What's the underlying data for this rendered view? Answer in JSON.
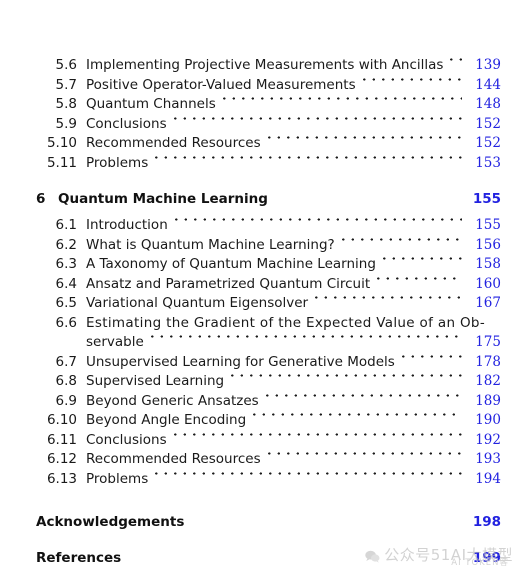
{
  "document": {
    "type": "table-of-contents"
  },
  "entries": [
    {
      "number": "5.6",
      "title": "Implementing Projective Measurements with Ancillas",
      "page": "139"
    },
    {
      "number": "5.7",
      "title": "Positive Operator-Valued Measurements",
      "page": "144"
    },
    {
      "number": "5.8",
      "title": "Quantum Channels",
      "page": "148"
    },
    {
      "number": "5.9",
      "title": "Conclusions",
      "page": "152"
    },
    {
      "number": "5.10",
      "title": "Recommended Resources",
      "page": "152"
    },
    {
      "number": "5.11",
      "title": "Problems",
      "page": "153"
    }
  ],
  "chapter": {
    "number": "6",
    "title": "Quantum Machine Learning",
    "page": "155"
  },
  "chapter_entries": [
    {
      "number": "6.1",
      "title": "Introduction",
      "page": "155"
    },
    {
      "number": "6.2",
      "title": "What is Quantum Machine Learning?",
      "page": "156"
    },
    {
      "number": "6.3",
      "title": "A Taxonomy of Quantum Machine Learning",
      "page": "158"
    },
    {
      "number": "6.4",
      "title": "Ansatz and Parametrized Quantum Circuit",
      "page": "160"
    },
    {
      "number": "6.5",
      "title": "Variational Quantum Eigensolver",
      "page": "167"
    }
  ],
  "wrapped_entry": {
    "number": "6.6",
    "title_line1": "Estimating the Gradient of the Expected Value of an Ob-",
    "title_line2": "servable",
    "page": "175"
  },
  "chapter_entries_2": [
    {
      "number": "6.7",
      "title": "Unsupervised Learning for Generative Models",
      "page": "178"
    },
    {
      "number": "6.8",
      "title": "Supervised Learning",
      "page": "182"
    },
    {
      "number": "6.9",
      "title": "Beyond Generic Ansatzes",
      "page": "189"
    },
    {
      "number": "6.10",
      "title": "Beyond Angle Encoding",
      "page": "190"
    },
    {
      "number": "6.11",
      "title": "Conclusions",
      "page": "192"
    },
    {
      "number": "6.12",
      "title": "Recommended Resources",
      "page": "193"
    },
    {
      "number": "6.13",
      "title": "Problems",
      "page": "194"
    }
  ],
  "backmatter": [
    {
      "title": "Acknowledgements",
      "page": "198"
    },
    {
      "title": "References",
      "page": "199"
    }
  ],
  "watermark": {
    "text": "公众号51AI大模型",
    "sub": "AI TOKEN客",
    "color": "#b8b8b8"
  },
  "colors": {
    "page_number": "#2222e0",
    "text": "#1a1a1a",
    "background": "#ffffff"
  }
}
